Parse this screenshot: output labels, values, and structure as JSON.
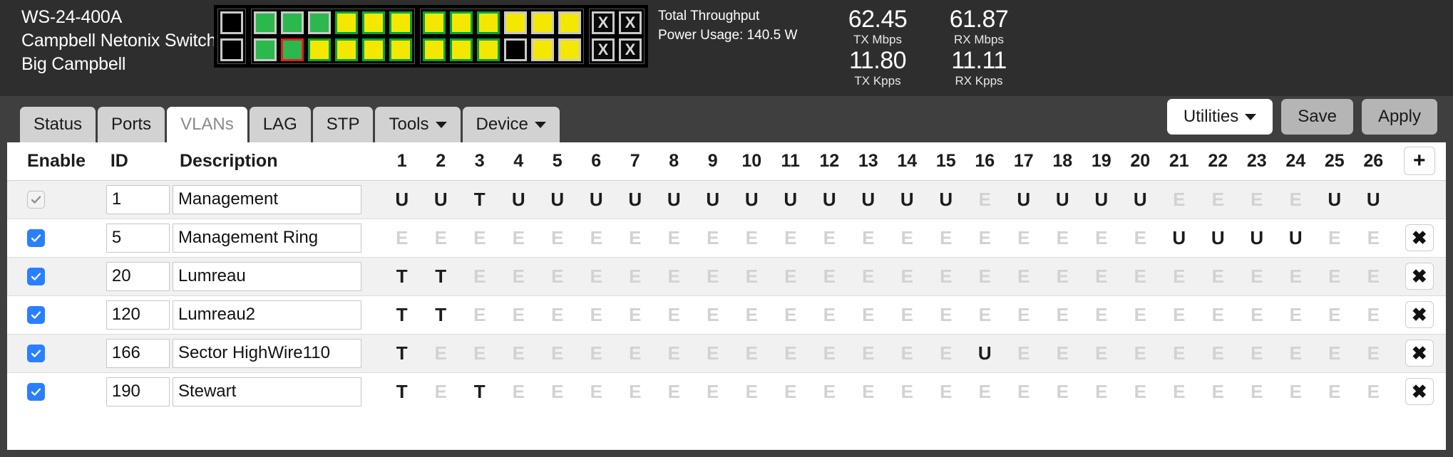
{
  "device": {
    "model": "WS-24-400A",
    "name": "Campbell Netonix Switch",
    "location": "Big Campbell"
  },
  "stats": {
    "throughput_label": "Total Throughput",
    "power_label": "Power Usage: 140.5 W",
    "tx_mbps_value": "62.45",
    "tx_mbps_unit": "TX Mbps",
    "rx_mbps_value": "61.87",
    "rx_mbps_unit": "RX Mbps",
    "tx_kpps_value": "11.80",
    "tx_kpps_unit": "TX Kpps",
    "rx_kpps_value": "11.11",
    "rx_kpps_unit": "RX Kpps"
  },
  "port_panel": {
    "sfp_label": "X",
    "groups": [
      {
        "name": "uplink-group",
        "type": "rj45",
        "top": [
          "off"
        ],
        "bottom": [
          "off"
        ]
      },
      {
        "name": "ports-1-12",
        "type": "rj45",
        "top": [
          "graygreen",
          "graygreen",
          "graygreen",
          "greenyellow",
          "greenyellow",
          "greenyellow"
        ],
        "bottom": [
          "graygreen",
          "redgreen",
          "greenyellow",
          "greenyellow",
          "greenyellow",
          "greenyellow"
        ]
      },
      {
        "name": "ports-13-20",
        "type": "rj45",
        "top": [
          "greenyellow",
          "greenyellow",
          "greenyellow",
          "grayyellow",
          "grayyellow",
          "grayyellow"
        ],
        "bottom": [
          "greenyellow",
          "greenyellow",
          "greenyellow",
          "grayblack",
          "grayyellow",
          "grayyellow"
        ]
      },
      {
        "name": "sfp-ports",
        "type": "sfp",
        "top": [
          "x",
          "x"
        ],
        "bottom": [
          "x",
          "x"
        ]
      }
    ]
  },
  "tabs": [
    {
      "label": "Status",
      "active": false,
      "caret": false
    },
    {
      "label": "Ports",
      "active": false,
      "caret": false
    },
    {
      "label": "VLANs",
      "active": true,
      "caret": false
    },
    {
      "label": "LAG",
      "active": false,
      "caret": false
    },
    {
      "label": "STP",
      "active": false,
      "caret": false
    },
    {
      "label": "Tools",
      "active": false,
      "caret": true
    },
    {
      "label": "Device",
      "active": false,
      "caret": true
    }
  ],
  "actions": {
    "utilities_label": "Utilities",
    "save_label": "Save",
    "apply_label": "Apply"
  },
  "table": {
    "headers": {
      "enable": "Enable",
      "id": "ID",
      "description": "Description"
    },
    "port_numbers": [
      "1",
      "2",
      "3",
      "4",
      "5",
      "6",
      "7",
      "8",
      "9",
      "10",
      "11",
      "12",
      "13",
      "14",
      "15",
      "16",
      "17",
      "18",
      "19",
      "20",
      "21",
      "22",
      "23",
      "24",
      "25",
      "26"
    ],
    "add_label": "+",
    "delete_label": "✖",
    "rows": [
      {
        "enabled": true,
        "enable_locked": true,
        "id": "1",
        "description": "Management",
        "deletable": false,
        "ports": [
          "U",
          "U",
          "T",
          "U",
          "U",
          "U",
          "U",
          "U",
          "U",
          "U",
          "U",
          "U",
          "U",
          "U",
          "U",
          "E",
          "U",
          "U",
          "U",
          "U",
          "E",
          "E",
          "E",
          "E",
          "U",
          "U"
        ]
      },
      {
        "enabled": true,
        "enable_locked": false,
        "id": "5",
        "description": "Management Ring",
        "deletable": true,
        "ports": [
          "E",
          "E",
          "E",
          "E",
          "E",
          "E",
          "E",
          "E",
          "E",
          "E",
          "E",
          "E",
          "E",
          "E",
          "E",
          "E",
          "E",
          "E",
          "E",
          "E",
          "U",
          "U",
          "U",
          "U",
          "E",
          "E"
        ]
      },
      {
        "enabled": true,
        "enable_locked": false,
        "id": "20",
        "description": "Lumreau",
        "deletable": true,
        "ports": [
          "T",
          "T",
          "E",
          "E",
          "E",
          "E",
          "E",
          "E",
          "E",
          "E",
          "E",
          "E",
          "E",
          "E",
          "E",
          "E",
          "E",
          "E",
          "E",
          "E",
          "E",
          "E",
          "E",
          "E",
          "E",
          "E"
        ]
      },
      {
        "enabled": true,
        "enable_locked": false,
        "id": "120",
        "description": "Lumreau2",
        "deletable": true,
        "ports": [
          "T",
          "T",
          "E",
          "E",
          "E",
          "E",
          "E",
          "E",
          "E",
          "E",
          "E",
          "E",
          "E",
          "E",
          "E",
          "E",
          "E",
          "E",
          "E",
          "E",
          "E",
          "E",
          "E",
          "E",
          "E",
          "E"
        ]
      },
      {
        "enabled": true,
        "enable_locked": false,
        "id": "166",
        "description": "Sector HighWire110",
        "deletable": true,
        "ports": [
          "T",
          "E",
          "E",
          "E",
          "E",
          "E",
          "E",
          "E",
          "E",
          "E",
          "E",
          "E",
          "E",
          "E",
          "E",
          "U",
          "E",
          "E",
          "E",
          "E",
          "E",
          "E",
          "E",
          "E",
          "E",
          "E"
        ]
      },
      {
        "enabled": true,
        "enable_locked": false,
        "id": "190",
        "description": "Stewart",
        "deletable": true,
        "ports": [
          "T",
          "E",
          "T",
          "E",
          "E",
          "E",
          "E",
          "E",
          "E",
          "E",
          "E",
          "E",
          "E",
          "E",
          "E",
          "E",
          "E",
          "E",
          "E",
          "E",
          "E",
          "E",
          "E",
          "E",
          "E",
          "E"
        ]
      }
    ]
  }
}
